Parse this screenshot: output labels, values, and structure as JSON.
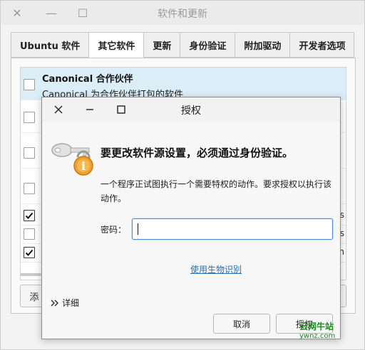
{
  "background_window": {
    "title": "软件和更新",
    "tabs": [
      {
        "label": "Ubuntu 软件",
        "active": false
      },
      {
        "label": "其它软件",
        "active": true
      },
      {
        "label": "更新",
        "active": false
      },
      {
        "label": "身份验证",
        "active": false
      },
      {
        "label": "附加驱动",
        "active": false
      },
      {
        "label": "开发者选项",
        "active": false
      }
    ],
    "list": {
      "first_item": {
        "title": "Canonical 合作伙伴",
        "subtitle": "Canonical 为合作伙伴打包的软件",
        "checked": false
      },
      "checkbox_states": [
        false,
        false,
        false,
        false,
        true,
        false,
        true
      ]
    },
    "visible_button_fragment": "添"
  },
  "dialog": {
    "title": "授权",
    "heading": "要更改软件源设置，必须通过身份验证。",
    "description": "一个程序正试图执行一个需要特权的动作。要求授权以执行该动作。",
    "password_label": "密码：",
    "password_value": "",
    "biometric_link": "使用生物识别",
    "details_label": "详细",
    "cancel_label": "取消",
    "authorize_label": "授权"
  },
  "watermark": {
    "text": "云网牛站",
    "domain": "ywnz.com"
  },
  "colors": {
    "selection": "#dbeef8",
    "link": "#2a6fb0",
    "focus": "#4a90d9",
    "lock_badge": "#f0a030"
  }
}
